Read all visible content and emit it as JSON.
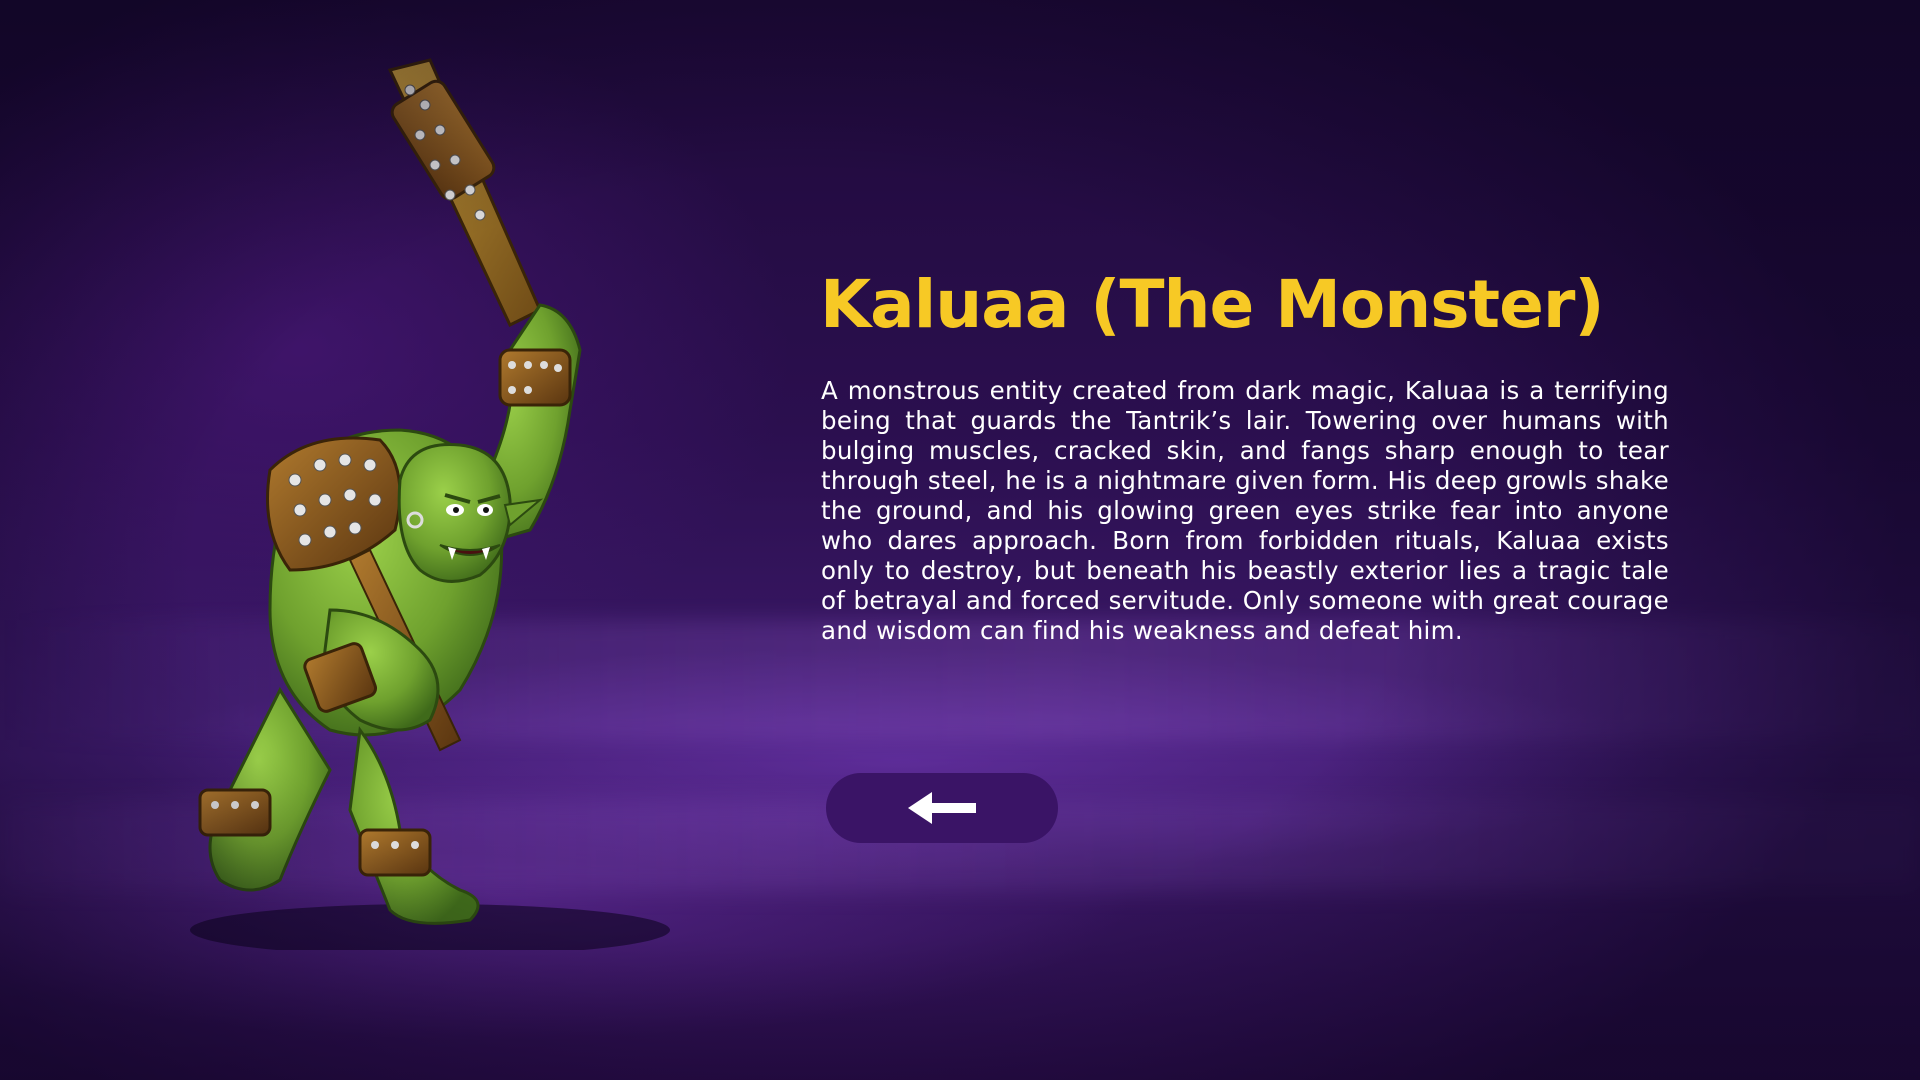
{
  "screen": {
    "title": "Kaluaa (The Monster)",
    "description": "A monstrous entity created from dark magic, Kaluaa is a terrifying being that guards the Tantrik’s lair. Towering over humans with bulging muscles, cracked skin, and fangs sharp enough to tear through steel, he is a nightmare given form. His deep growls shake the ground, and his glowing green eyes strike fear into anyone who dares approach. Born from forbidden rituals, Kaluaa exists only to destroy, but beneath his beastly exterior lies a tragic tale of betrayal and forced servitude. Only someone with great courage and wisdom can find his weakness and defeat him."
  },
  "character": {
    "name_icon": "green-ogre-with-spiked-club"
  },
  "back_button": {
    "icon": "arrow-left-icon"
  },
  "colors": {
    "title": "#f7c925",
    "text": "#ffffff",
    "button_bg": "#3a1466",
    "background": "#2b0f4f",
    "ogre_skin": "#7fb23a"
  }
}
